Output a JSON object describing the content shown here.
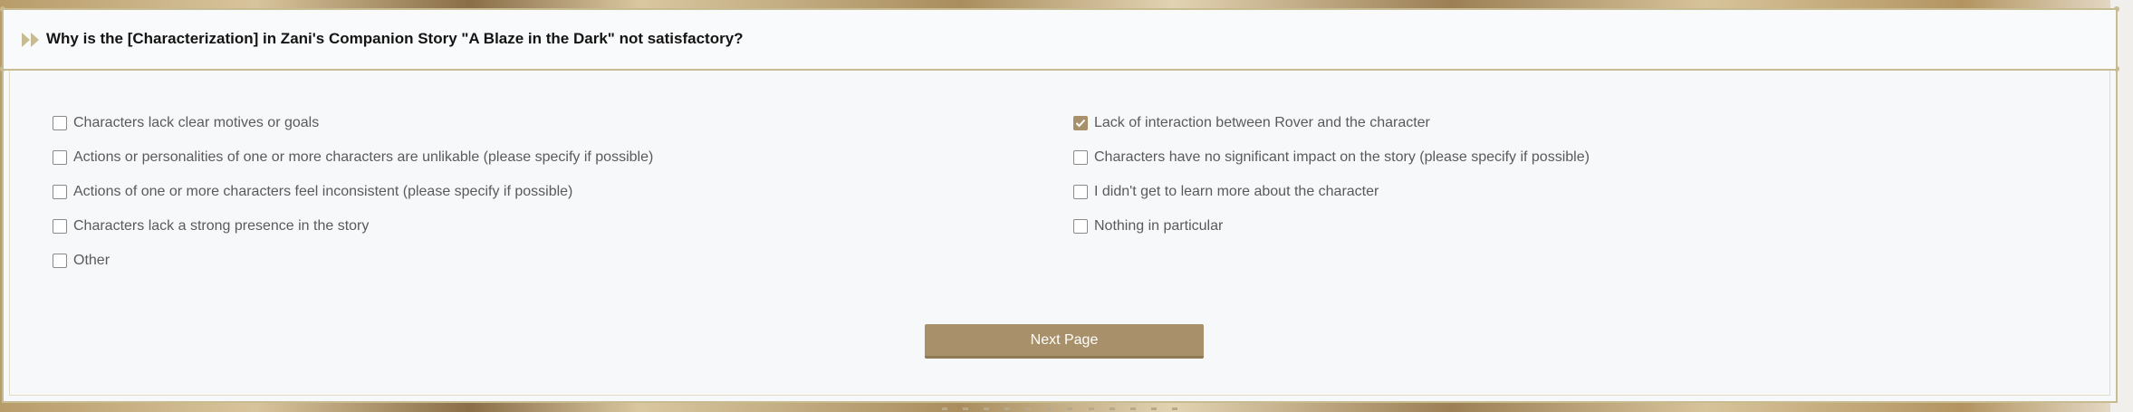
{
  "question": {
    "title": "Why is the [Characterization] in Zani's Companion Story \"A Blaze in the Dark\" not satisfactory?"
  },
  "options_left": [
    {
      "label": "Characters lack clear motives or goals",
      "checked": false
    },
    {
      "label": "Actions or personalities of one or more characters are unlikable (please specify if possible)",
      "checked": false
    },
    {
      "label": "Actions of one or more characters feel inconsistent (please specify if possible)",
      "checked": false
    },
    {
      "label": "Characters lack a strong presence in the story",
      "checked": false
    },
    {
      "label": "Other",
      "checked": false
    }
  ],
  "options_right": [
    {
      "label": "Lack of interaction between Rover and the character",
      "checked": true
    },
    {
      "label": "Characters have no significant impact on the story (please specify if possible)",
      "checked": false
    },
    {
      "label": "I didn't get to learn more about the character",
      "checked": false
    },
    {
      "label": "Nothing in particular",
      "checked": false
    }
  ],
  "next_button": {
    "label": "Next Page"
  },
  "colors": {
    "accent": "#a8906a",
    "border": "#c7bb92",
    "text": "#5a5a5a"
  },
  "icons": {
    "header": "double-chevron-right-icon",
    "checkmark": "checkmark-icon"
  }
}
